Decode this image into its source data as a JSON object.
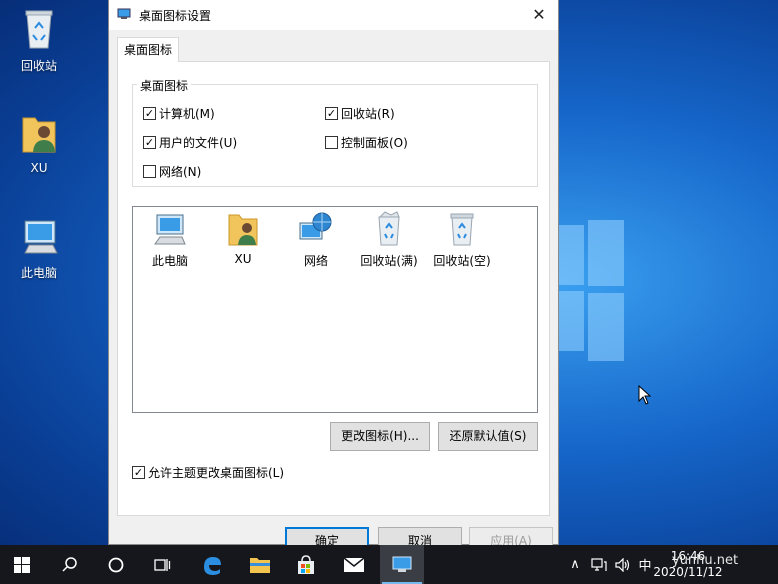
{
  "desktop": {
    "icons": [
      {
        "label": "回收站",
        "icon": "recycle-bin-icon"
      },
      {
        "label": "XU",
        "icon": "user-folder-icon"
      },
      {
        "label": "此电脑",
        "icon": "computer-icon"
      }
    ]
  },
  "dialog": {
    "title": "桌面图标设置",
    "close_glyph": "✕",
    "tab_label": "桌面图标",
    "group_label": "桌面图标",
    "checkboxes": [
      {
        "label": "计算机(M)",
        "checked": true
      },
      {
        "label": "回收站(R)",
        "checked": true
      },
      {
        "label": "用户的文件(U)",
        "checked": true
      },
      {
        "label": "控制面板(O)",
        "checked": false
      },
      {
        "label": "网络(N)",
        "checked": false
      }
    ],
    "icon_list": [
      {
        "label": "此电脑",
        "icon": "computer-icon"
      },
      {
        "label": "XU",
        "icon": "user-folder-icon"
      },
      {
        "label": "网络",
        "icon": "network-icon"
      },
      {
        "label": "回收站(满)",
        "icon": "recycle-bin-full-icon"
      },
      {
        "label": "回收站(空)",
        "icon": "recycle-bin-empty-icon"
      }
    ],
    "change_icon_button": "更改图标(H)...",
    "restore_default_button": "还原默认值(S)",
    "allow_themes_checkbox": {
      "label": "允许主题更改桌面图标(L)",
      "checked": true
    },
    "ok_button": "确定",
    "cancel_button": "取消",
    "apply_button": "应用(A)"
  },
  "taskbar": {
    "ime_label": "中",
    "time": "16:46",
    "date": "2020/11/12",
    "chevron_glyph": "∧"
  },
  "watermark": "yunhu.net",
  "colors": {
    "accent": "#0078d7",
    "taskbar": "#15171c",
    "desktop": "#1565c8"
  }
}
